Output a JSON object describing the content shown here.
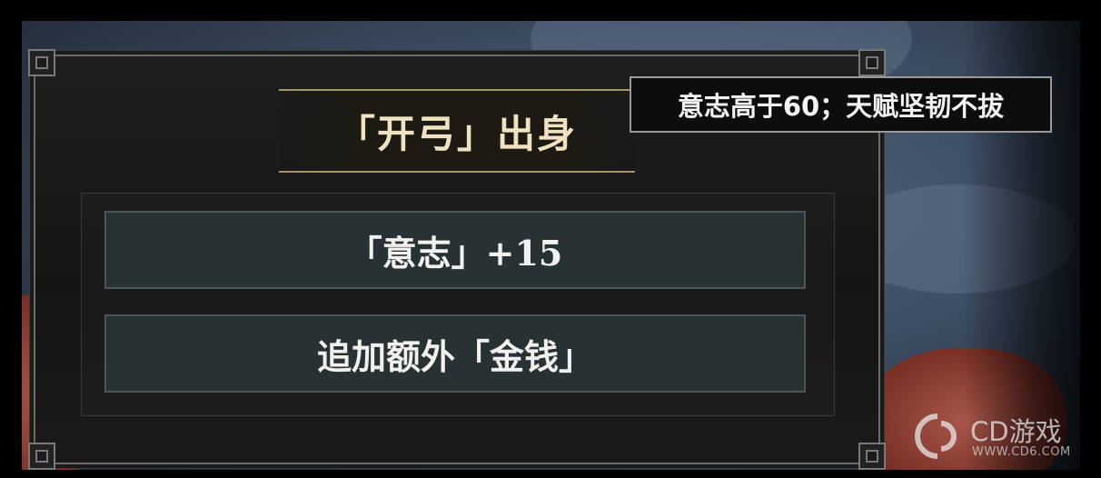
{
  "popup": {
    "title": "「开弓」出身",
    "tooltip": "意志高于60；天赋坚韧不拔",
    "options": [
      {
        "label": "「意志」+15"
      },
      {
        "label": "追加额外「金钱」"
      }
    ]
  },
  "watermark": {
    "name": "CD游戏",
    "url": "WWW.CD6.COM"
  },
  "colors": {
    "title_text": "#efe3c2",
    "title_border": "#a4946a",
    "option_bg": "#283134",
    "panel_bg": "#1a1a1a"
  }
}
